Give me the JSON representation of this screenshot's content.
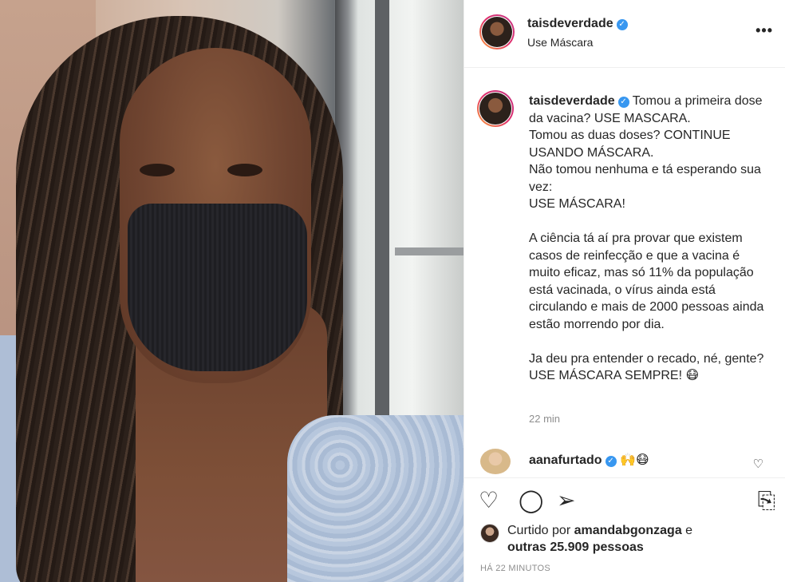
{
  "post": {
    "username": "taisdeverdade",
    "location": "Use Máscara",
    "more_icon": "•••",
    "verified_icon": "✓"
  },
  "caption": {
    "username": "taisdeverdade",
    "text": " Tomou a primeira dose da vacina? USE MASCARA.\nTomou as duas doses? CONTINUE USANDO MÁSCARA.\nNão tomou nenhuma e tá esperando sua vez:\nUSE MÁSCARA!\n\nA ciência tá aí pra provar que existem casos de reinfecção e que a vacina é muito eficaz, mas só 11% da população está vacinada, o vírus ainda está circulando e mais de 2000 pessoas ainda estão morrendo por dia.\n\nJa deu pra entender o recado, né, gente? USE MÁSCARA SEMPRE! 😷",
    "time": "22 min"
  },
  "comment": {
    "username": "aanafurtado",
    "text": " 🙌😷",
    "like_icon": "♡"
  },
  "actions": {
    "like_icon": "♡",
    "comment_icon": "◯",
    "share_icon": "➢",
    "save_icon": "⎘"
  },
  "likes": {
    "prefix": "Curtido por ",
    "by": "amandabgonzaga",
    "mid": " e",
    "others": "outras 25.909 pessoas"
  },
  "posted_ago": "HÁ 22 MINUTOS"
}
